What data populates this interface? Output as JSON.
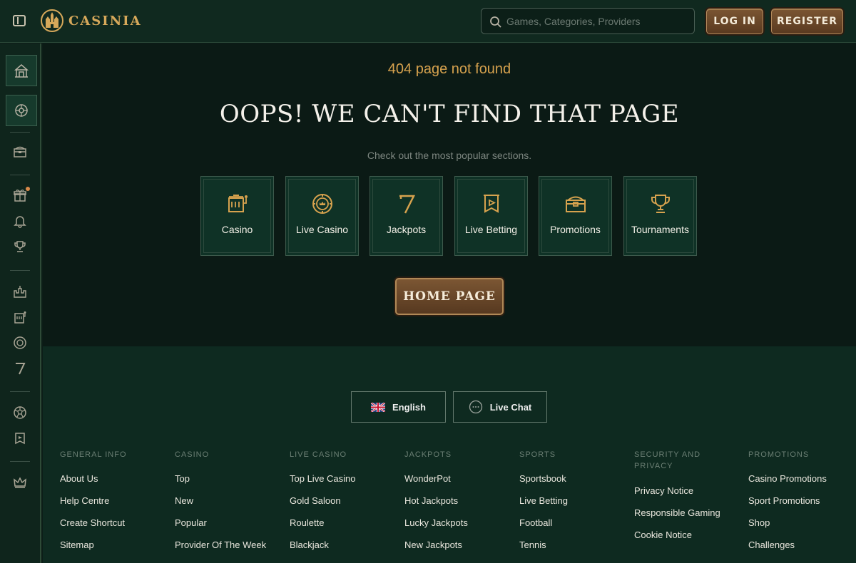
{
  "header": {
    "brand": "CASINIA",
    "search_placeholder": "Games, Categories, Providers",
    "login_label": "LOG IN",
    "register_label": "REGISTER"
  },
  "sidebar": {
    "items": [
      {
        "icon": "casino-building-icon"
      },
      {
        "icon": "roulette-wheel-icon"
      },
      {
        "icon": "treasure-chest-icon"
      },
      {
        "icon": "gift-icon"
      },
      {
        "icon": "bell-icon"
      },
      {
        "icon": "trophy-icon"
      },
      {
        "icon": "castle-icon"
      },
      {
        "icon": "slot-machine-icon"
      },
      {
        "icon": "chip-icon"
      },
      {
        "icon": "seven-icon"
      },
      {
        "icon": "soccer-ball-icon"
      },
      {
        "icon": "betting-flag-icon"
      },
      {
        "icon": "crown-icon"
      }
    ]
  },
  "error": {
    "code_text": "404 page not found",
    "title": "OOPS! WE CAN'T FIND THAT PAGE",
    "subtitle": "Check out the most popular sections."
  },
  "sections": [
    {
      "label": "Casino",
      "icon": "slot-machine-icon"
    },
    {
      "label": "Live Casino",
      "icon": "chip-icon"
    },
    {
      "label": "Jackpots",
      "icon": "seven-icon"
    },
    {
      "label": "Live Betting",
      "icon": "betting-flag-icon"
    },
    {
      "label": "Promotions",
      "icon": "treasure-chest-icon"
    },
    {
      "label": "Tournaments",
      "icon": "trophy-icon"
    }
  ],
  "home_button": "HOME PAGE",
  "footer": {
    "language": "English",
    "live_chat": "Live Chat",
    "columns": [
      {
        "heading": "GENERAL INFO",
        "links": [
          "About Us",
          "Help Centre",
          "Create Shortcut",
          "Sitemap"
        ]
      },
      {
        "heading": "CASINO",
        "links": [
          "Top",
          "New",
          "Popular",
          "Provider Of The Week"
        ]
      },
      {
        "heading": "LIVE CASINO",
        "links": [
          "Top Live Casino",
          "Gold Saloon",
          "Roulette",
          "Blackjack"
        ]
      },
      {
        "heading": "JACKPOTS",
        "links": [
          "WonderPot",
          "Hot Jackpots",
          "Lucky Jackpots",
          "New Jackpots"
        ]
      },
      {
        "heading": "SPORTS",
        "links": [
          "Sportsbook",
          "Live Betting",
          "Football",
          "Tennis"
        ]
      },
      {
        "heading": "SECURITY AND PRIVACY",
        "links": [
          "Privacy Notice",
          "Responsible Gaming",
          "Cookie Notice"
        ]
      },
      {
        "heading": "PROMOTIONS",
        "links": [
          "Casino Promotions",
          "Sport Promotions",
          "Shop",
          "Challenges"
        ]
      }
    ]
  },
  "colors": {
    "accent_gold": "#d6a24e",
    "background": "#0b1a15",
    "footer": "#0e2a20"
  }
}
